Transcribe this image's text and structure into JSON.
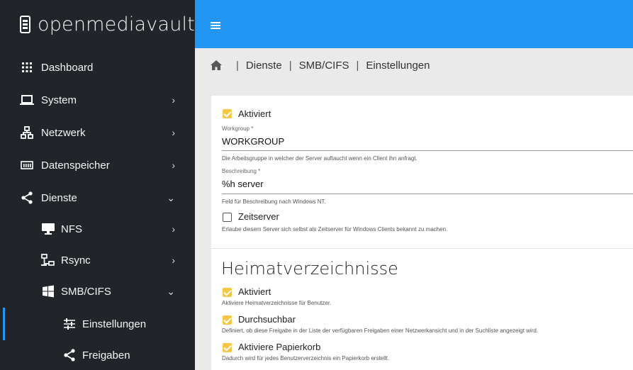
{
  "brand": {
    "name": "openmediavault"
  },
  "sidebar": {
    "items": [
      {
        "label": "Dashboard",
        "icon": "grid-icon"
      },
      {
        "label": "System",
        "icon": "laptop-icon",
        "chevron": "›"
      },
      {
        "label": "Netzwerk",
        "icon": "network-icon",
        "chevron": "›"
      },
      {
        "label": "Datenspeicher",
        "icon": "storage-icon",
        "chevron": "›"
      },
      {
        "label": "Dienste",
        "icon": "share-icon",
        "chevron": "⌄"
      },
      {
        "label": "NFS",
        "icon": "desktop-icon",
        "chevron": "›"
      },
      {
        "label": "Rsync",
        "icon": "rsync-icon",
        "chevron": "›"
      },
      {
        "label": "SMB/CIFS",
        "icon": "windows-icon",
        "chevron": "⌄"
      },
      {
        "label": "Einstellungen",
        "icon": "sliders-icon"
      },
      {
        "label": "Freigaben",
        "icon": "share-icon"
      }
    ]
  },
  "breadcrumb": {
    "items": [
      "Dienste",
      "SMB/CIFS",
      "Einstellungen"
    ],
    "separator": "|"
  },
  "settings": {
    "enabled_label": "Aktiviert",
    "workgroup_label": "Workgroup *",
    "workgroup_value": "WORKGROUP",
    "workgroup_hint": "Die Arbeitsgruppe in welcher der Server auftaucht wenn ein Client ihn anfragt.",
    "description_label": "Beschreibung *",
    "description_value": "%h server",
    "description_hint": "Feld für Beschreibung nach Windows NT.",
    "timeserver_label": "Zeitserver",
    "timeserver_hint": "Erlaube diesem Server sich selbst als Zeitserver für Windows Clients bekannt zu machen."
  },
  "homes": {
    "title": "Heimatverzeichnisse",
    "enabled_label": "Aktiviert",
    "enabled_hint": "Aktiviere Heimatverzeichnisse für Benutzer.",
    "browsable_label": "Durchsuchbar",
    "browsable_hint": "Definiert, ob diese Freigabe in der Liste der verfügbaren Freigaben einer Netzwerkansicht und in der Suchliste angezeigt wird.",
    "recycle_label": "Aktiviere Papierkorb",
    "recycle_hint": "Dadurch wird für jedes Benutzerverzeichnis ein Papierkorb erstellt."
  },
  "colors": {
    "sidebar_bg": "#212529",
    "topbar_bg": "#2196f3",
    "checkbox_on": "#f6c646"
  }
}
